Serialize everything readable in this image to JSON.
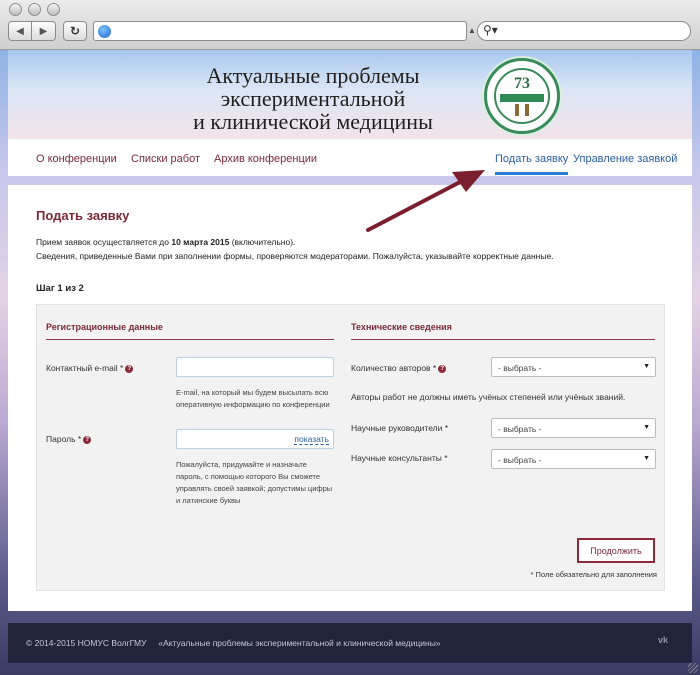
{
  "header": {
    "banner_title_line1": "Актуальные проблемы",
    "banner_title_line2": "экспериментальной",
    "banner_title_line3": "и клинической медицины",
    "emblem_number": "73"
  },
  "topnav": {
    "items": [
      {
        "label": "О конференции"
      },
      {
        "label": "Списки работ"
      },
      {
        "label": "Архив конференции"
      },
      {
        "label": "Подать заявку"
      },
      {
        "label": "Управление заявкой"
      }
    ]
  },
  "main": {
    "title": "Подать заявку",
    "intro_before": "Прием заявок осуществляется до ",
    "intro_date": "10 марта 2015",
    "intro_after": " (включительно).",
    "intro_line2": "Сведения, приведенные Вами при заполнении формы, проверяются модераторами. Пожалуйста, указывайте корректные данные.",
    "step": "Шаг 1 из 2"
  },
  "form": {
    "reg_title": "Регистрационные данные",
    "tech_title": "Технические сведения",
    "email_label": "Контактный e-mail *",
    "email_value": "",
    "email_hint_line1": "E-mail, на который мы будем высылать всю",
    "email_hint_line2": "оперативную информацию по конференции",
    "password_label": "Пароль *",
    "password_value": "",
    "show_label": "показать",
    "password_hint_line1": "Пожалуйста, придумайте и назначьте",
    "password_hint_line2": "пароль, с помощью которого Вы сможете",
    "password_hint_line3": "управлять своей заявкой; допустимы цифры",
    "password_hint_line4": "и латинские буквы",
    "authors_label": "Количество авторов *",
    "authors_value": "- выбрать -",
    "authors_note": "Авторы работ не должны иметь учёных степеней или учёных званий.",
    "supervisors_label": "Научные руководители *",
    "supervisors_value": "- выбрать -",
    "consultants_label": "Научные консультанты *",
    "consultants_value": "- выбрать -",
    "submit_label": "Продолжить",
    "required_note": "* Поле обязательно для заполнения"
  },
  "footer": {
    "copyright": "© 2014-2015 НОМУС ВолгГМУ",
    "project": "«Актуальные проблемы экспериментальной и клинической медицины»",
    "vk_label": "vk"
  },
  "colors": {
    "accent_maroon": "#7a2a3a",
    "link_blue": "#2a5f9e",
    "footer_bg": "#22243c"
  },
  "icons": [
    "back-icon",
    "forward-icon",
    "reload-icon",
    "globe-icon",
    "search-icon",
    "help-icon",
    "vk-icon"
  ]
}
